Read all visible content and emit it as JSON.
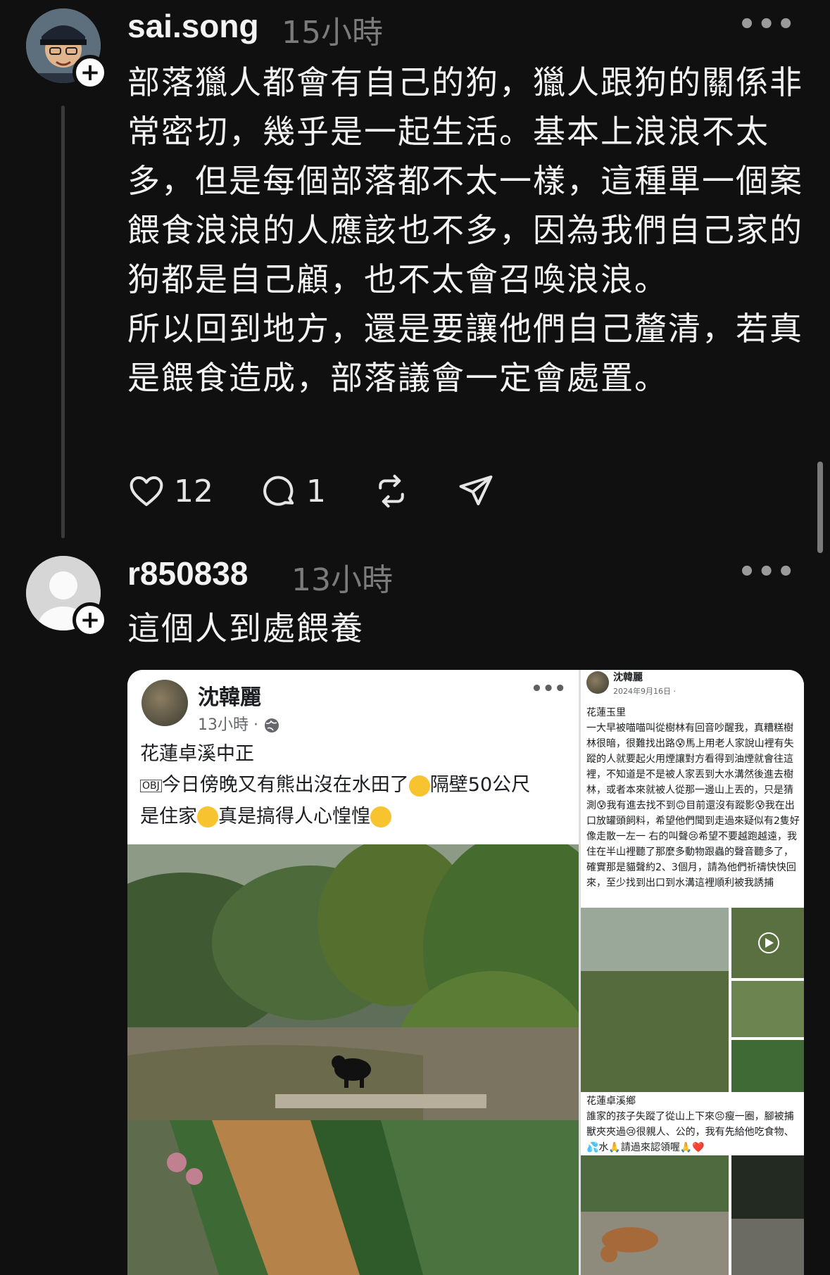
{
  "post1": {
    "username": "sai.song",
    "time": "15小時",
    "paragraphs": [
      "部落獵人都會有自己的狗，獵人跟狗的關係非常密切，幾乎是一起生活。基本上浪浪不太多，但是每個部落都不太一樣，這種單一個案餵食浪浪的人應該也不多，因為我們自己家的狗都是自己顧，也不太會召喚浪浪。",
      "所以回到地方，還是要讓他們自己釐清，若真是餵食造成，部落議會一定會處置。"
    ],
    "likes": "12",
    "comments": "1"
  },
  "post2": {
    "username": "r850838",
    "time": "13小時",
    "text": "這個人到處餵養"
  },
  "attachment": {
    "left": {
      "name": "沈韓麗",
      "meta": "13小時 · ",
      "line1": "花蓮卓溪中正",
      "line2": "今日傍晚又有熊出沒在水田了",
      "line2b": "隔壁50公尺",
      "line3": "是住家",
      "line3b": "真是搞得人心惶惶"
    },
    "right": {
      "name": "沈韓麗",
      "date": "2024年9月16日 · ",
      "location": "花蓮玉里",
      "body": "一大早被喵喵叫從樹林有回音吵醒我，真糟糕樹林很暗，很難找出路😰馬上用老人家說山裡有失蹤的人就要起火用煙讓對方看得到油煙就會往這裡，不知道是不是被人家丟到大水溝然後進去樹林，或者本來就被人從那一邊山上丟的，只是猜測😰我有進去找不到🙃目前還沒有蹤影😰我在出口放罐頭飼料，希望他們聞到走過來疑似有2隻好像走散一左一 右的叫聲😢希望不要越跑越遠，我住在半山裡聽了那麼多動物跟蟲的聲音聽多了，確實那是貓聲約2、3個月，請為他們祈禱快快回來，至少找到出口到水溝這裡順利被我誘捕",
      "location2": "花蓮卓溪鄉",
      "body2": "誰家的孩子失蹤了從山上下來😣瘦一圈，腳被捕獸夾夾過😢很親人、公的，我有先給他吃食物、💦水🙏請過來認領喔🙏❤️"
    }
  },
  "colors": {
    "background": "#101010",
    "text": "#f3f3f3",
    "muted": "#7b7b7b"
  }
}
